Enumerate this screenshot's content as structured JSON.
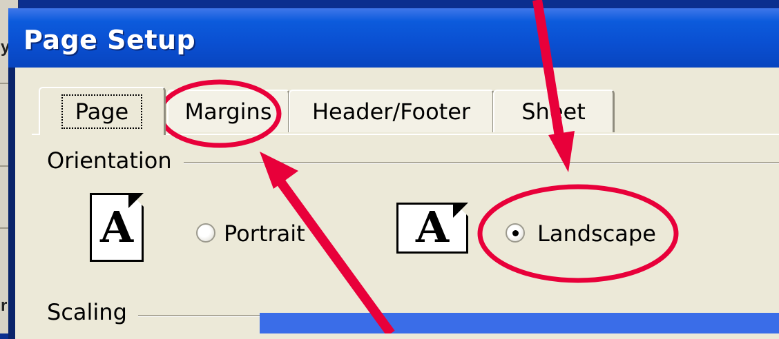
{
  "window": {
    "title": "Page Setup"
  },
  "tabs": [
    {
      "label": "Page"
    },
    {
      "label": "Margins"
    },
    {
      "label": "Header/Footer"
    },
    {
      "label": "Sheet"
    }
  ],
  "orientation": {
    "group_label": "Orientation",
    "portrait_label": "Portrait",
    "landscape_label": "Landscape",
    "icon_glyph": "A",
    "selected": "Landscape"
  },
  "scaling": {
    "group_label": "Scaling"
  },
  "colors": {
    "titlebar": "#0a4fd1",
    "dialog_bg": "#ece9d8",
    "annotation": "#e8003a"
  }
}
